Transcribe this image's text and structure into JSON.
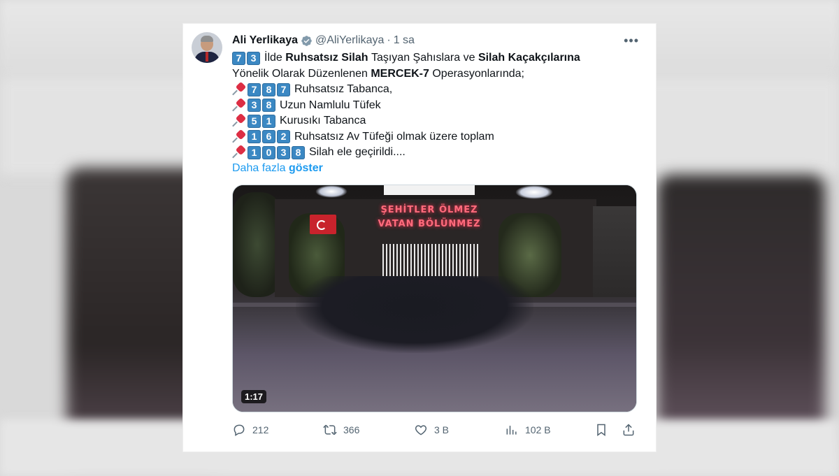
{
  "tweet": {
    "author_name": "Ali Yerlikaya",
    "handle": "@AliYerlikaya",
    "separator": "·",
    "time": "1 sa",
    "more_icon": "more-horizontal-icon",
    "lines": {
      "l1_keycaps": [
        "7",
        "3"
      ],
      "l1_a": "İlde",
      "l1_b": "Ruhsatsız Silah",
      "l1_c": "Taşıyan Şahıslara ve",
      "l1_d": "Silah Kaçakçılarına",
      "l2_a": "Yönelik Olarak Düzenlenen",
      "l2_b": "MERCEK-7",
      "l2_c": "Operasyonlarında;",
      "l3_keycaps": [
        "7",
        "8",
        "7"
      ],
      "l3_text": "Ruhsatsız Tabanca,",
      "l4_keycaps": [
        "3",
        "8"
      ],
      "l4_text": "Uzun Namlulu Tüfek",
      "l5_keycaps": [
        "5",
        "1"
      ],
      "l5_text": "Kurusıkı Tabanca",
      "l6_keycaps": [
        "1",
        "6",
        "2"
      ],
      "l6_text": "Ruhsatsız Av Tüfeği olmak üzere toplam",
      "l7_keycaps": [
        "1",
        "0",
        "3",
        "8"
      ],
      "l7_text": "Silah ele geçirildi...."
    },
    "show_more_a": "Daha fazla",
    "show_more_b": "göster",
    "video": {
      "sign_line1": "ŞEHİTLER ÖLMEZ",
      "sign_line2": "VATAN BÖLÜNMEZ",
      "duration": "1:17"
    },
    "stats": {
      "replies": "212",
      "reposts": "366",
      "likes": "3 B",
      "views": "102 B"
    }
  }
}
